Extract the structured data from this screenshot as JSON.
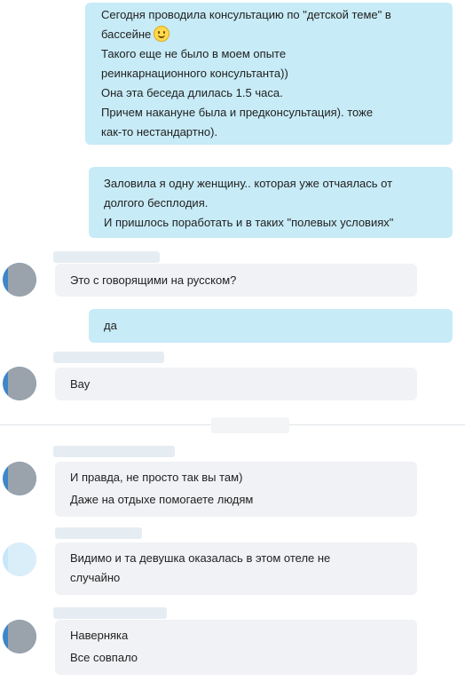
{
  "chat": {
    "messages": [
      {
        "direction": "out",
        "lines": [
          "Сегодня проводила консультацию по \"детской теме\" в",
          "бассейне",
          "Такого еще не было в моем опыте",
          "реинкарнационного консультанта))",
          "Она эта беседа длилась 1.5 часа.",
          "Причем накануне была и предконсультация). тоже",
          "как-то нестандартно)."
        ],
        "emoji": "smile-emoji"
      },
      {
        "direction": "out",
        "lines": [
          "Заловила я одну женщину.. которая уже отчаялась от",
          "долгого бесплодия.",
          "И пришлось поработать и в таких \"полевых условиях\""
        ]
      },
      {
        "direction": "in",
        "lines": [
          "Это с говорящими на русском?"
        ]
      },
      {
        "direction": "out",
        "lines": [
          "да"
        ]
      },
      {
        "direction": "in",
        "lines": [
          "Вау"
        ]
      },
      {
        "direction": "in",
        "lines": [
          "И правда, не просто так вы там)",
          "Даже на отдыхе помогаете людям"
        ]
      },
      {
        "direction": "in",
        "lines": [
          "Видимо и та девушка оказалась в этом отеле не",
          "случайно"
        ]
      },
      {
        "direction": "in",
        "lines": [
          "Наверняка",
          "Все совпало"
        ]
      }
    ]
  },
  "colors": {
    "outgoing_bubble": "#c7ebf7",
    "incoming_bubble": "#f0f2f5",
    "text": "#222222"
  }
}
